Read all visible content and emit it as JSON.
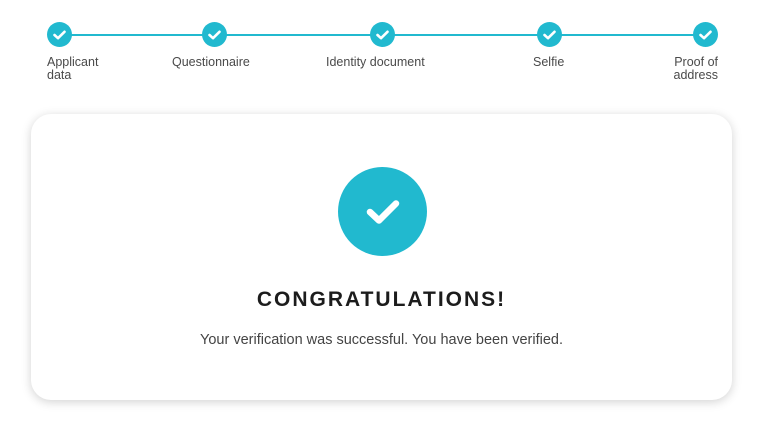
{
  "colors": {
    "accent": "#21b9cf",
    "card_background": "#ffffff",
    "heading": "#1c1c1c",
    "text": "#444444"
  },
  "stepper": {
    "steps": [
      {
        "label": "Applicant\ndata",
        "status": "completed",
        "icon": "check-icon"
      },
      {
        "label": "Questionnaire",
        "status": "completed",
        "icon": "check-icon"
      },
      {
        "label": "Identity document",
        "status": "completed",
        "icon": "check-icon"
      },
      {
        "label": "Selfie",
        "status": "completed",
        "icon": "check-icon"
      },
      {
        "label": "Proof of\naddress",
        "status": "completed",
        "icon": "check-icon"
      }
    ]
  },
  "result": {
    "icon": "success-check-icon",
    "title": "CONGRATULATIONS!",
    "message": "Your verification was successful. You have been verified."
  }
}
